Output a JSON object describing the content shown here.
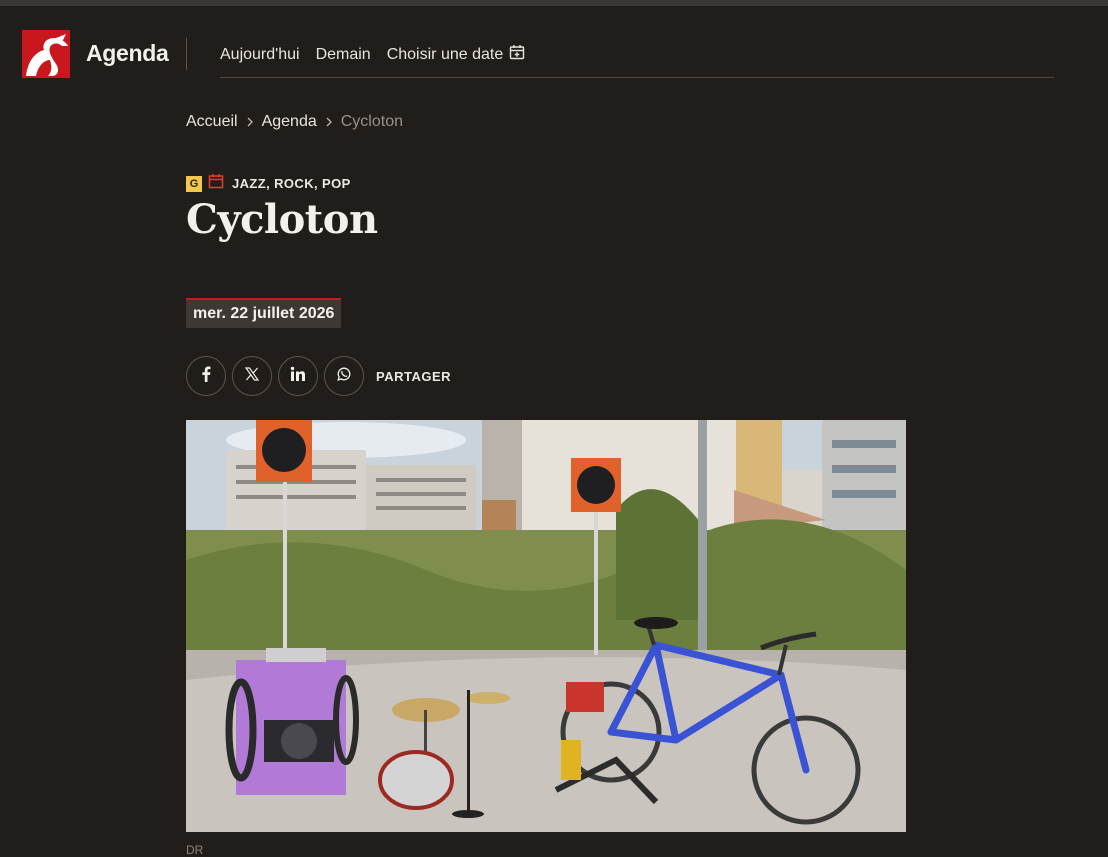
{
  "header": {
    "brand": "Agenda",
    "logo_icon": "swan-logo-icon",
    "nav": [
      {
        "label": "Aujourd'hui"
      },
      {
        "label": "Demain"
      },
      {
        "label": "Choisir une date",
        "icon": "calendar-plus-icon"
      }
    ]
  },
  "breadcrumb": {
    "items": [
      "Accueil",
      "Agenda"
    ],
    "current": "Cycloton"
  },
  "event": {
    "badge": "G",
    "category": "JAZZ, ROCK, POP",
    "title": "Cycloton",
    "date": "mer. 22 juillet 2026"
  },
  "share": {
    "label": "PARTAGER",
    "buttons": [
      "facebook-icon",
      "x-icon",
      "linkedin-icon",
      "whatsapp-icon"
    ]
  },
  "photo": {
    "credit": "DR"
  },
  "colors": {
    "background": "#211d1a",
    "accent": "#c8181e",
    "badge": "#f2c94c"
  }
}
